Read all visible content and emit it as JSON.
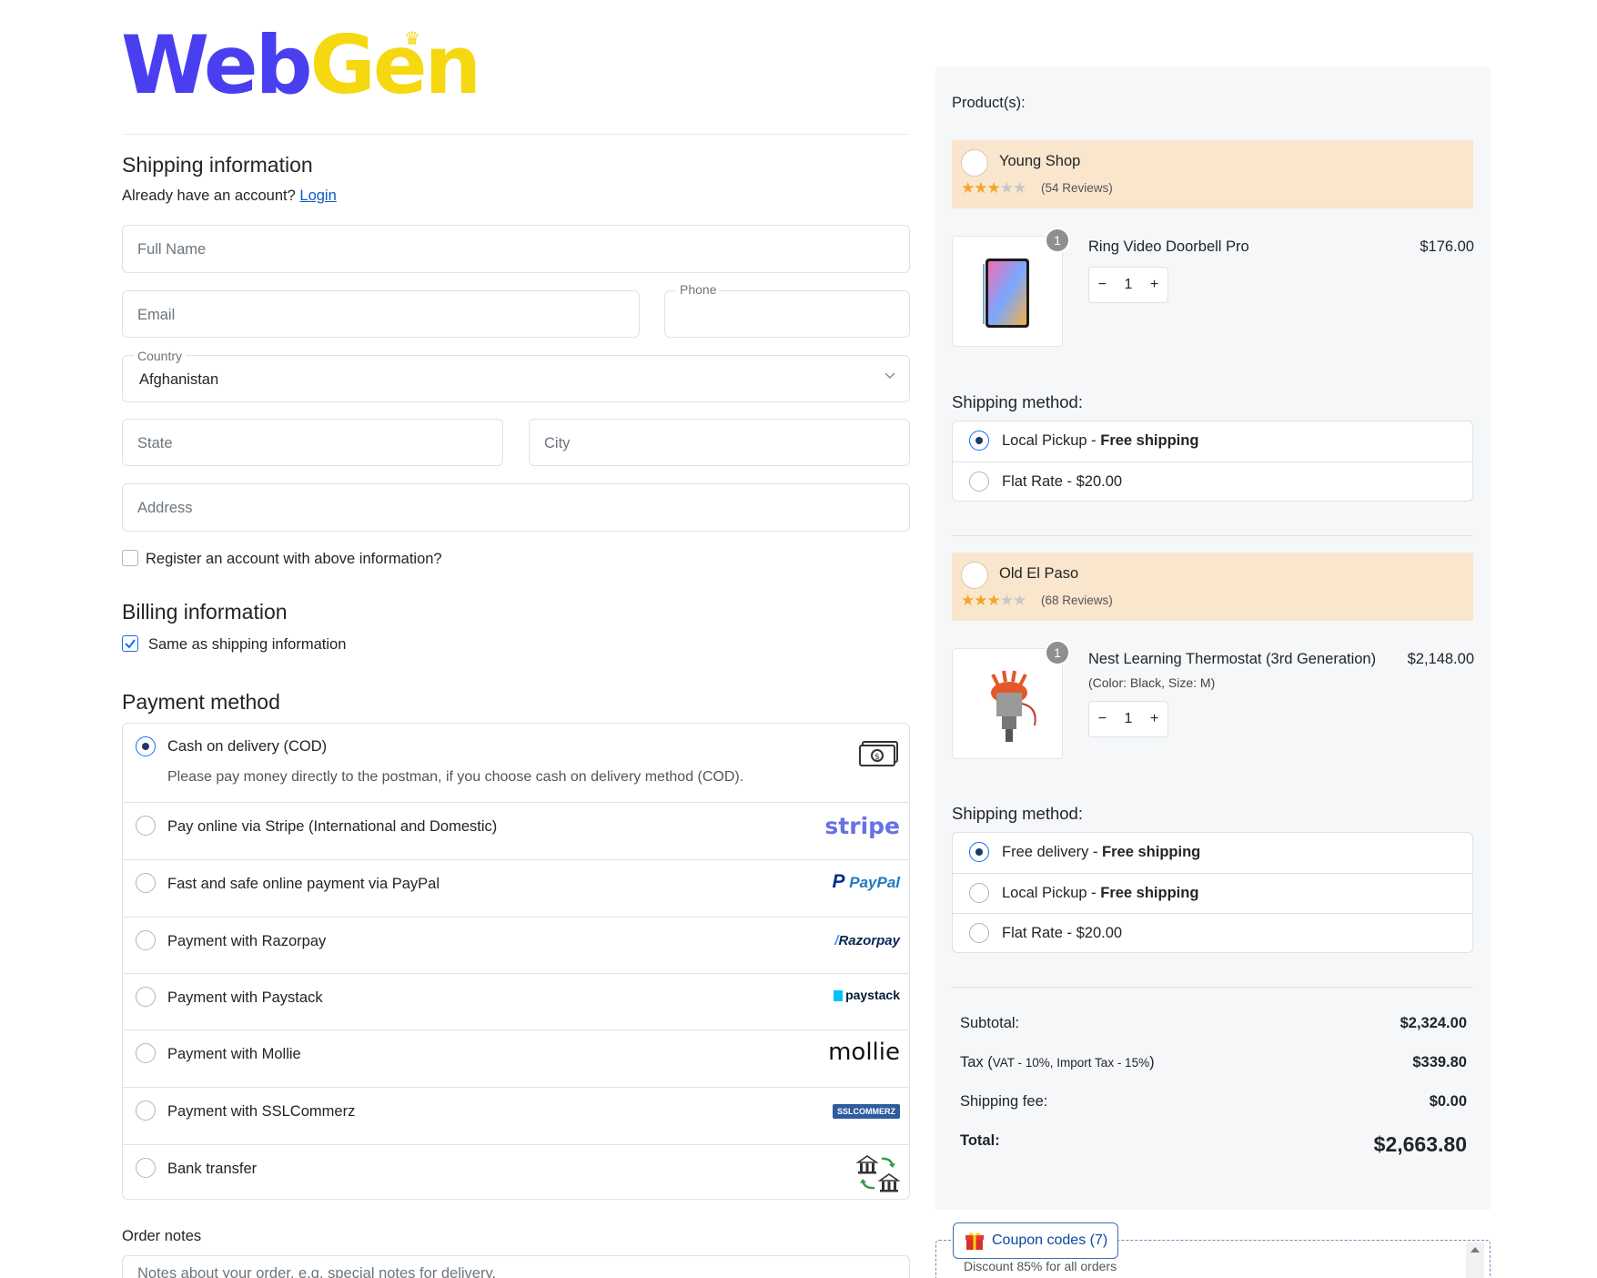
{
  "logo": {
    "part1": "Web",
    "part2": "Gen"
  },
  "shipping": {
    "title": "Shipping information",
    "account_prompt": "Already have an account?",
    "login_link": "Login",
    "full_name_placeholder": "Full Name",
    "email_placeholder": "Email",
    "phone_label": "Phone",
    "country_label": "Country",
    "country_value": "Afghanistan",
    "state_placeholder": "State",
    "city_placeholder": "City",
    "address_placeholder": "Address",
    "register_label": "Register an account with above information?"
  },
  "billing": {
    "title": "Billing information",
    "same_label": "Same as shipping information",
    "same_checked": true
  },
  "payment": {
    "title": "Payment method",
    "methods": [
      {
        "label": "Cash on delivery (COD)",
        "description": "Please pay money directly to the postman, if you choose cash on delivery method (COD).",
        "selected": true,
        "logo": "cash-icon"
      },
      {
        "label": "Pay online via Stripe (International and Domestic)",
        "logo_text": "stripe"
      },
      {
        "label": "Fast and safe online payment via PayPal",
        "logo_text": "PayPal"
      },
      {
        "label": "Payment with Razorpay",
        "logo_text": "Razorpay"
      },
      {
        "label": "Payment with Paystack",
        "logo_text": "paystack"
      },
      {
        "label": "Payment with Mollie",
        "logo_text": "mollie"
      },
      {
        "label": "Payment with SSLCommerz",
        "logo_text": "SSLCOMMERZ"
      },
      {
        "label": "Bank transfer",
        "logo": "bank-transfer-icon"
      }
    ]
  },
  "order_notes": {
    "label": "Order notes",
    "placeholder": "Notes about your order, e.g. special notes for delivery."
  },
  "cart": {
    "products_label": "Product(s):",
    "shops": [
      {
        "name": "Young Shop",
        "rating": 3,
        "reviews": "(54 Reviews)",
        "product": {
          "name": "Ring Video Doorbell Pro",
          "price": "$176.00",
          "qty": "1",
          "badge": "1",
          "variant": ""
        },
        "shipping_title": "Shipping method:",
        "shipping_options": [
          {
            "name": "Local Pickup",
            "sep": " - ",
            "price": "Free shipping",
            "price_bold": true,
            "selected": true
          },
          {
            "name": "Flat Rate",
            "sep": " - ",
            "price": "$20.00",
            "price_bold": false,
            "selected": false
          }
        ]
      },
      {
        "name": "Old El Paso",
        "rating": 3,
        "reviews": "(68 Reviews)",
        "product": {
          "name": "Nest Learning Thermostat (3rd Generation)",
          "price": "$2,148.00",
          "qty": "1",
          "badge": "1",
          "variant": "(Color: Black, Size: M)"
        },
        "shipping_title": "Shipping method:",
        "shipping_options": [
          {
            "name": "Free delivery",
            "sep": " - ",
            "price": "Free shipping",
            "price_bold": true,
            "selected": true
          },
          {
            "name": "Local Pickup",
            "sep": " - ",
            "price": "Free shipping",
            "price_bold": true,
            "selected": false
          },
          {
            "name": "Flat Rate",
            "sep": " - ",
            "price": "$20.00",
            "price_bold": false,
            "selected": false
          }
        ]
      }
    ],
    "summary": {
      "subtotal_label": "Subtotal:",
      "subtotal": "$2,324.00",
      "tax_label": "Tax (",
      "tax_detail": "VAT - 10%, Import Tax - 15%",
      "tax_close": ")",
      "tax": "$339.80",
      "shipping_label": "Shipping fee:",
      "shipping": "$0.00",
      "total_label": "Total:",
      "total": "$2,663.80"
    }
  },
  "coupon": {
    "button_label": "Coupon codes (7)",
    "first_offer": "Discount 85% for all orders"
  },
  "colors": {
    "brand_blue": "#4a3ff0",
    "brand_yellow": "#f5d80f",
    "shop_header": "#fae6cc",
    "accent": "#0d6efd"
  }
}
